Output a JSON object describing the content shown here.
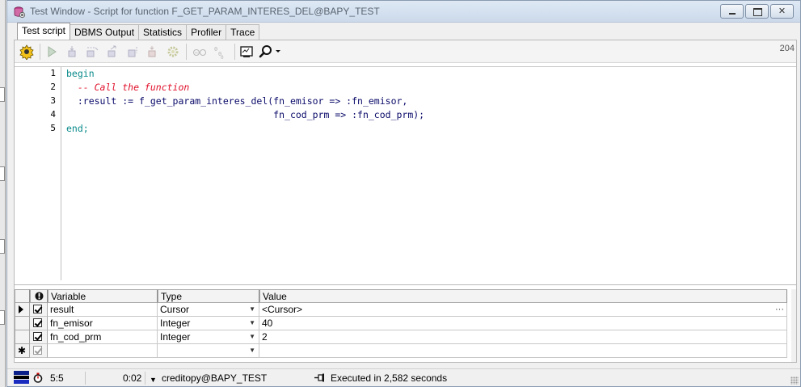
{
  "window": {
    "title": "Test Window - Script for function F_GET_PARAM_INTERES_DEL@BAPY_TEST"
  },
  "tabs": [
    {
      "label": "Test script",
      "active": true
    },
    {
      "label": "DBMS Output",
      "active": false
    },
    {
      "label": "Statistics",
      "active": false
    },
    {
      "label": "Profiler",
      "active": false
    },
    {
      "label": "Trace",
      "active": false
    }
  ],
  "toolbar": {
    "counter": "204",
    "icons": [
      "execute-icon",
      "step-icon",
      "step-into-icon",
      "step-over-icon",
      "step-out-icon",
      "run-to-exception-icon",
      "debug-settings-icon",
      "watch-icon",
      "variables-icon",
      "dbms-output-icon",
      "find-icon"
    ]
  },
  "editor": {
    "line_numbers": [
      "1",
      "2",
      "3",
      "4",
      "5"
    ],
    "lines": [
      {
        "text": "begin",
        "kind": "kw"
      },
      {
        "text": "  -- Call the function",
        "kind": "cm"
      },
      {
        "text": "  :result := f_get_param_interes_del(fn_emisor => :fn_emisor,",
        "kind": "id"
      },
      {
        "text": "                                     fn_cod_prm => :fn_cod_prm);",
        "kind": "id"
      },
      {
        "text": "end;",
        "kind": "kw"
      }
    ]
  },
  "variables": {
    "headers": {
      "variable": "Variable",
      "type": "Type",
      "value": "Value"
    },
    "rows": [
      {
        "name": "result",
        "type": "Cursor",
        "value": "<Cursor>",
        "checked": true,
        "current": true
      },
      {
        "name": "fn_emisor",
        "type": "Integer",
        "value": "40",
        "checked": true,
        "current": false
      },
      {
        "name": "fn_cod_prm",
        "type": "Integer",
        "value": "2",
        "checked": true,
        "current": false
      },
      {
        "name": "",
        "type": "",
        "value": "",
        "checked": true,
        "current": false,
        "new": true
      }
    ]
  },
  "status": {
    "position": "5:5",
    "time": "0:02",
    "connection": "creditopy@BAPY_TEST",
    "message": "Executed in 2,582 seconds"
  }
}
